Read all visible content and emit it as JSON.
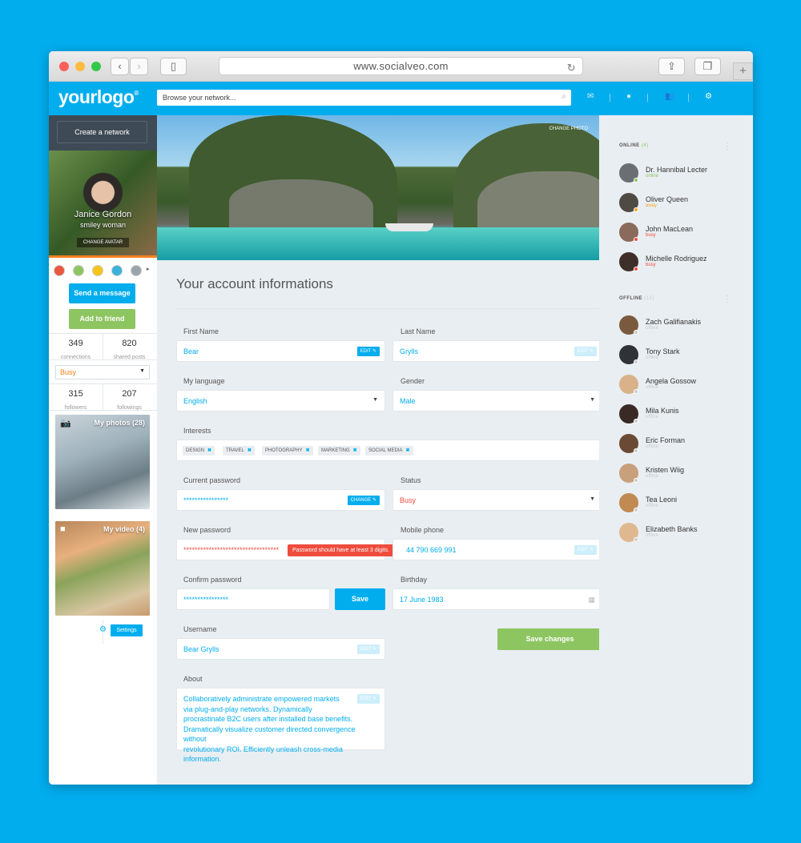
{
  "browser": {
    "url": "www.socialveo.com",
    "new_tab": "+"
  },
  "header": {
    "logo": "yourlogo",
    "search_placeholder": "Browse your network..."
  },
  "left": {
    "create_network": "Create a network",
    "name": "Janice Gordon",
    "subtitle": "smiley woman",
    "change_avatar": "CHANGE AVATAR",
    "send_message": "Send a message",
    "add_friend": "Add to friend",
    "stats": [
      {
        "value": "349",
        "label": "connections"
      },
      {
        "value": "820",
        "label": "shared posts"
      },
      {
        "value": "315",
        "label": "followers"
      },
      {
        "value": "207",
        "label": "followings"
      }
    ],
    "status_select": "Busy",
    "photos_title": "My photos (28)",
    "videos_title": "My video (4)",
    "settings": "Settings"
  },
  "cover": {
    "change_photo": "CHANGE PHOTO"
  },
  "form": {
    "title": "Your account informations",
    "first_name": {
      "label": "First Name",
      "value": "Bear",
      "btn": "EDIT"
    },
    "last_name": {
      "label": "Last Name",
      "value": "Grylls",
      "btn": "EDIT"
    },
    "language": {
      "label": "My language",
      "value": "English"
    },
    "gender": {
      "label": "Gender",
      "value": "Male"
    },
    "interests": {
      "label": "Interests",
      "tags": [
        "DESIGN",
        "TRAVEL",
        "PHOTOGRAPHY",
        "MARKETING",
        "SOCIAL MEDIA"
      ]
    },
    "current_password": {
      "label": "Current password",
      "value": "****************",
      "btn": "CHANGE"
    },
    "status": {
      "label": "Status",
      "value": "Busy"
    },
    "new_password": {
      "label": "New password",
      "value": "**********************************",
      "tooltip": "Password should have at least 3 digits."
    },
    "mobile": {
      "label": "Mobile phone",
      "value": "44 790 669 991",
      "btn": "EDIT"
    },
    "confirm_password": {
      "label": "Confirm password",
      "value": "****************",
      "btn": "Save"
    },
    "birthday": {
      "label": "Birthday",
      "value": "17 June 1983"
    },
    "username": {
      "label": "Username",
      "value": "Bear Grylls",
      "btn": "EDIT"
    },
    "save_changes": "Save changes",
    "about": {
      "label": "About",
      "btn": "EDIT",
      "lines": [
        "Collaboratively administrate empowered markets",
        "via plug-and-play networks. Dynamically",
        "procrastinate B2C users after installed base benefits.",
        "Dramatically visualize customer directed convergence without",
        "revolutionary ROI. Efficiently unleash cross-media information."
      ]
    }
  },
  "sidebar": {
    "online_label": "ONLINE",
    "online_count": "(4)",
    "offline_label": "OFFLINE",
    "offline_count": "(15)",
    "online": [
      {
        "name": "Dr. Hannibal Lecter",
        "status": "online"
      },
      {
        "name": "Oliver Queen",
        "status": "away"
      },
      {
        "name": "John MacLean",
        "status": "busy"
      },
      {
        "name": "Michelle Rodriguez",
        "status": "busy"
      }
    ],
    "offline": [
      {
        "name": "Zach Galifianakis",
        "status": "offline"
      },
      {
        "name": "Tony Stark",
        "status": "offline"
      },
      {
        "name": "Angela Gossow",
        "status": "offline"
      },
      {
        "name": "Mila Kunis",
        "status": "offline"
      },
      {
        "name": "Eric Forman",
        "status": "offline"
      },
      {
        "name": "Kristen Wiig",
        "status": "offline"
      },
      {
        "name": "Tea Leoni",
        "status": "offline"
      },
      {
        "name": "Elizabeth Banks",
        "status": "offline"
      }
    ]
  },
  "colors": {
    "accent": "#02adee",
    "green": "#8dc561",
    "busy": "#ef4c3d",
    "away": "#f5a623",
    "online": "#8dc561",
    "offline": "#cccccc"
  }
}
